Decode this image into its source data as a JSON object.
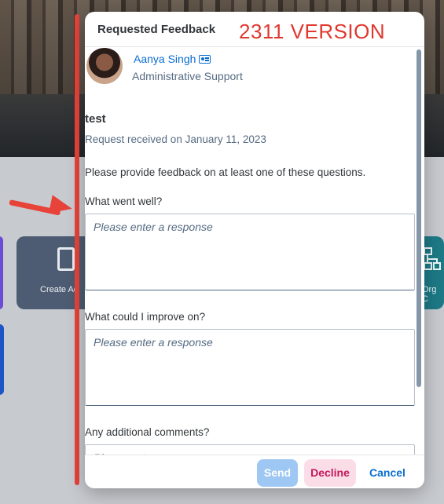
{
  "dialog": {
    "title": "Requested Feedback",
    "version_stamp": "2311 VERSION",
    "requester": {
      "name": "Aanya Singh",
      "role": "Administrative Support"
    },
    "request": {
      "title": "test",
      "received": "Request received on January 11, 2023",
      "intro": "Please provide feedback on at least one of these questions."
    },
    "questions": [
      {
        "label": "What went well?",
        "placeholder": "Please enter a response"
      },
      {
        "label": "What could I improve on?",
        "placeholder": "Please enter a response"
      },
      {
        "label": "Any additional comments?",
        "placeholder": "Please enter a response"
      }
    ],
    "footer": {
      "send_label": "Send",
      "decline_label": "Decline",
      "cancel_label": "Cancel"
    }
  },
  "background": {
    "tiles": [
      {
        "label": "Create Ac",
        "icon": "clipboard-icon"
      },
      {
        "label": "Org C",
        "icon": "org-chart-icon"
      }
    ]
  },
  "colors": {
    "accent": "#0a6ed1",
    "annotation": "#e0382f",
    "decline_bg": "#fbdde8",
    "decline_text": "#c4195a",
    "send_disabled": "#9ec7f3"
  }
}
